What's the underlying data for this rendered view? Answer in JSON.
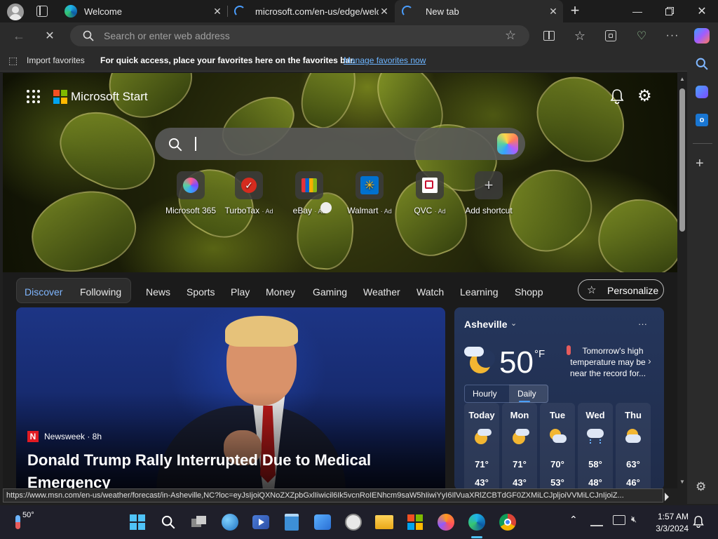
{
  "tabs": [
    {
      "label": "Welcome"
    },
    {
      "label": "microsoft.com/en-us/edge/welc"
    },
    {
      "label": "New tab"
    }
  ],
  "address": {
    "placeholder": "Search or enter web address"
  },
  "favorites_bar": {
    "import_label": "Import favorites",
    "hint": "For quick access, place your favorites here on the favorites bar.",
    "manage_link": "Manage favorites now"
  },
  "start": {
    "brand": "Microsoft Start",
    "shortcuts": [
      {
        "label": "Microsoft 365",
        "ad": ""
      },
      {
        "label": "TurboTax",
        "ad": "· Ad"
      },
      {
        "label": "eBay",
        "ad": "· Ad"
      },
      {
        "label": "Walmart",
        "ad": "· Ad"
      },
      {
        "label": "QVC",
        "ad": "· Ad"
      },
      {
        "label": "Add shortcut",
        "ad": ""
      }
    ]
  },
  "nav": {
    "discover": "Discover",
    "following": "Following",
    "items": [
      "News",
      "Sports",
      "Play",
      "Money",
      "Gaming",
      "Weather",
      "Watch",
      "Learning",
      "Shopp"
    ],
    "personalize": "Personalize"
  },
  "news": {
    "source": "Newsweek · 8h",
    "source_badge": "N",
    "headline": "Donald Trump Rally Interrupted Due to Medical Emergency"
  },
  "weather": {
    "city": "Asheville",
    "temp": "50",
    "unit": "°F",
    "alert": "Tomorrow's high temperature may be near the record for...",
    "tabs": [
      "Hourly",
      "Daily"
    ],
    "more": "···",
    "days": [
      {
        "name": "Today",
        "hi": "71°",
        "lo": "43°"
      },
      {
        "name": "Mon",
        "hi": "71°",
        "lo": "43°"
      },
      {
        "name": "Tue",
        "hi": "70°",
        "lo": "53°"
      },
      {
        "name": "Wed",
        "hi": "58°",
        "lo": "48°"
      },
      {
        "name": "Thu",
        "hi": "63°",
        "lo": "46°"
      }
    ]
  },
  "status_url": "https://www.msn.com/en-us/weather/forecast/in-Asheville,NC?loc=eyJsIjoiQXNoZXZpbGxlIiwicil6Ik5vcnRoIENhcm9saW5hIiwiYyI6IlVuaXRlZCBTdGF0ZXMiLCJpljoiVVMiLCJnIjoiZ...",
  "taskbar": {
    "weather_temp": "50°",
    "time": "1:57 AM",
    "date": "3/3/2024"
  },
  "colors": {
    "accent": "#4a9eff",
    "link": "#6cb4ff"
  }
}
